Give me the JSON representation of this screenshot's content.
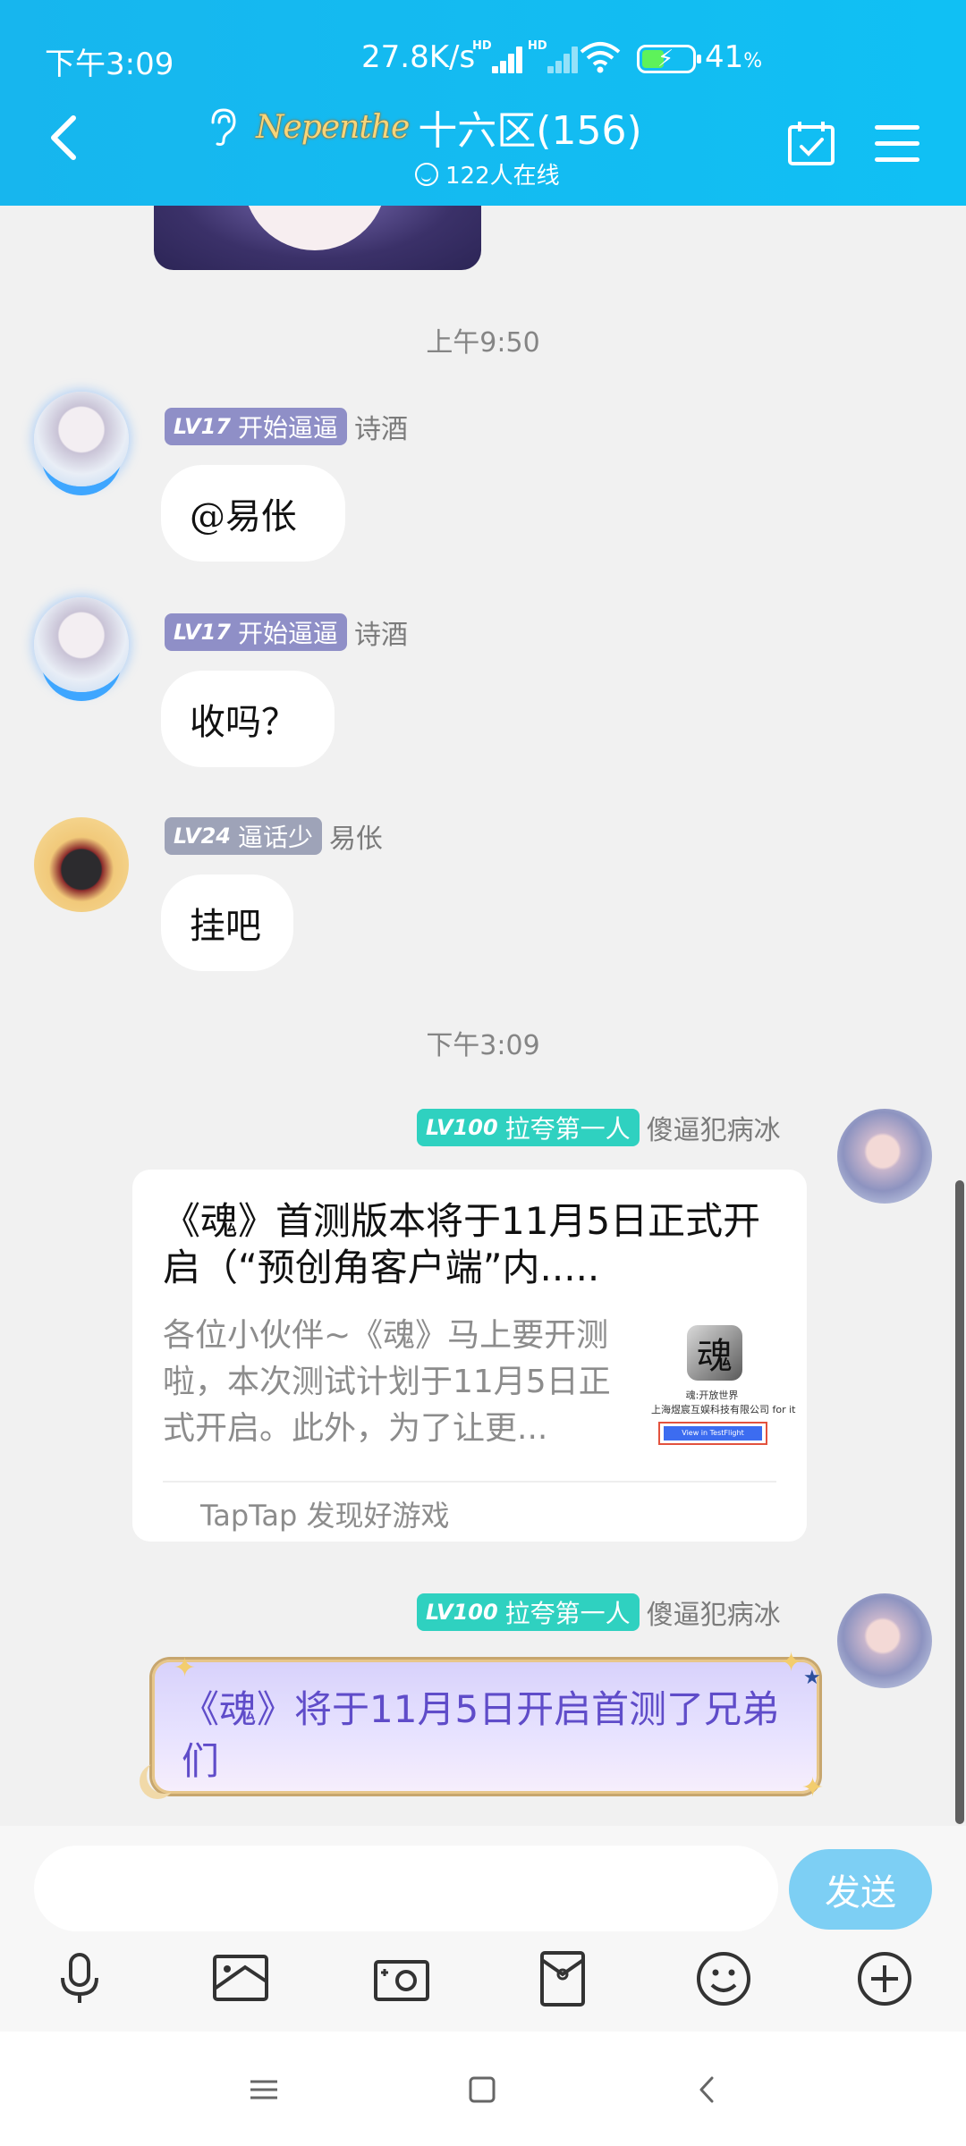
{
  "status_bar": {
    "time": "下午3:09",
    "net_speed": "27.8K/s",
    "signal_label": "HD",
    "battery_percent": "41",
    "battery_unit": "%"
  },
  "header": {
    "logo_text": "Nepenthe",
    "title": "十六区(156)",
    "online": "122人在线"
  },
  "messages": {
    "ts1": "上午9:50",
    "m1": {
      "level": "LV17",
      "title": "开始逼逼",
      "nick": "诗酒",
      "text": "@易伥"
    },
    "m2": {
      "level": "LV17",
      "title": "开始逼逼",
      "nick": "诗酒",
      "text": "收吗？"
    },
    "m3": {
      "level": "LV24",
      "title": "逼话少",
      "nick": "易伥",
      "text": "挂吧"
    },
    "ts2": "下午3:09",
    "m4": {
      "level": "LV100",
      "title": "拉夸第一人",
      "nick": "傻逼犯病冰",
      "card": {
        "title": "《魂》首测版本将于11月5日正式开启（“预创角客户端”内.....",
        "desc": "各位小伙伴~《魂》马上要开测啦，本次测试计划于11月5日正式开启。此外，为了让更...",
        "thumb_icon": "魂",
        "thumb_line1": "魂:开放世界",
        "thumb_line2": "上海煜宸互娱科技有限公司 for it",
        "thumb_button": "View in TestFlight",
        "source": "TapTap 发现好游戏"
      }
    },
    "m5": {
      "level": "LV100",
      "title": "拉夸第一人",
      "nick": "傻逼犯病冰",
      "text": "《魂》将于11月5日开启首测了兄弟们"
    }
  },
  "input": {
    "value": "",
    "placeholder": "",
    "send_label": "发送"
  },
  "toolbar_icons": [
    "microphone-icon",
    "image-icon",
    "camera-icon",
    "red-packet-icon",
    "emoji-icon",
    "plus-icon"
  ],
  "colors": {
    "header_bg": "#17b6ee",
    "send_button": "#7dcff4",
    "lv_teal": "#2fd1c0",
    "lv_purple": "#8f8fc7",
    "fancy_text": "#5f4cc9"
  }
}
